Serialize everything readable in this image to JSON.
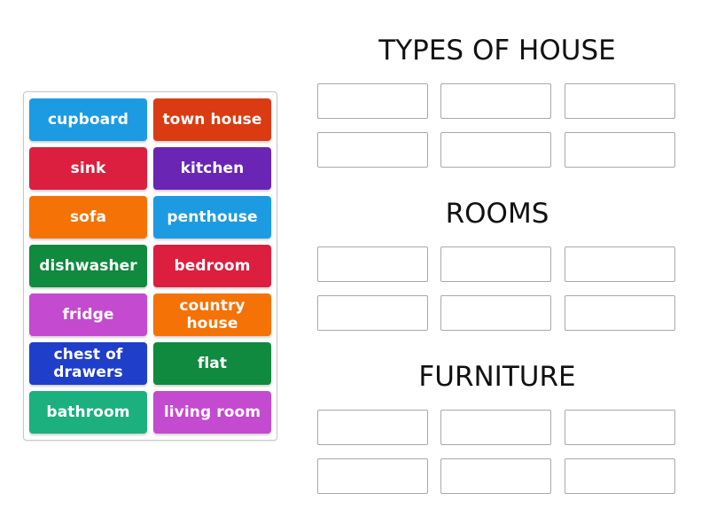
{
  "tiles": [
    {
      "label": "cupboard",
      "color": "#1d9be2"
    },
    {
      "label": "town house",
      "color": "#db3b12"
    },
    {
      "label": "sink",
      "color": "#dc1f3f"
    },
    {
      "label": "kitchen",
      "color": "#6a25b5"
    },
    {
      "label": "sofa",
      "color": "#f47206"
    },
    {
      "label": "penthouse",
      "color": "#1d9be2"
    },
    {
      "label": "dishwasher",
      "color": "#0f8a3e"
    },
    {
      "label": "bedroom",
      "color": "#dc1f3f"
    },
    {
      "label": "fridge",
      "color": "#c44ad0"
    },
    {
      "label": "country house",
      "color": "#f47206"
    },
    {
      "label": "chest of drawers",
      "color": "#1f3ec9"
    },
    {
      "label": "flat",
      "color": "#0f8a3e"
    },
    {
      "label": "bathroom",
      "color": "#1cb07f"
    },
    {
      "label": "living room",
      "color": "#c44ad0"
    }
  ],
  "groups": [
    {
      "title": "TYPES OF HOUSE",
      "slots": 6
    },
    {
      "title": "ROOMS",
      "slots": 6
    },
    {
      "title": "FURNITURE",
      "slots": 6
    }
  ]
}
